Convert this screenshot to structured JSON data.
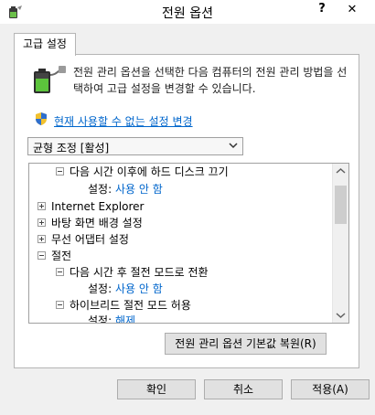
{
  "window": {
    "title": "전원 옵션",
    "help_label": "?",
    "close_label": "✕"
  },
  "tab": {
    "label": "고급 설정"
  },
  "description": "전원 관리 옵션을 선택한 다음 컴퓨터의 전원 관리 방법을 선택하여 고급 설정을 변경할 수 있습니다.",
  "change_link": "현재 사용할 수 없는 설정 변경",
  "plan_select": {
    "value": "균형 조정 [활성]"
  },
  "tree": {
    "row0": {
      "label": "다음 시간 이후에 하드 디스크 끄기"
    },
    "row1": {
      "key": "설정:",
      "value": "사용 안 함"
    },
    "row2": {
      "label": "Internet Explorer"
    },
    "row3": {
      "label": "바탕 화면 배경 설정"
    },
    "row4": {
      "label": "무선 어댑터 설정"
    },
    "row5": {
      "label": "절전"
    },
    "row6": {
      "label": "다음 시간 후 절전 모드로 전환"
    },
    "row7": {
      "key": "설정:",
      "value": "사용 안 함"
    },
    "row8": {
      "label": "하이브리드 절전 모드 허용"
    },
    "row9": {
      "key": "설정:",
      "value": "해제"
    }
  },
  "restore_button": "전원 관리 옵션 기본값 복원(R)",
  "buttons": {
    "ok": "확인",
    "cancel": "취소",
    "apply": "적용(A)"
  },
  "icons": {
    "app": "power-options-icon",
    "battery": "battery-plug-icon",
    "shield": "uac-shield-icon"
  }
}
